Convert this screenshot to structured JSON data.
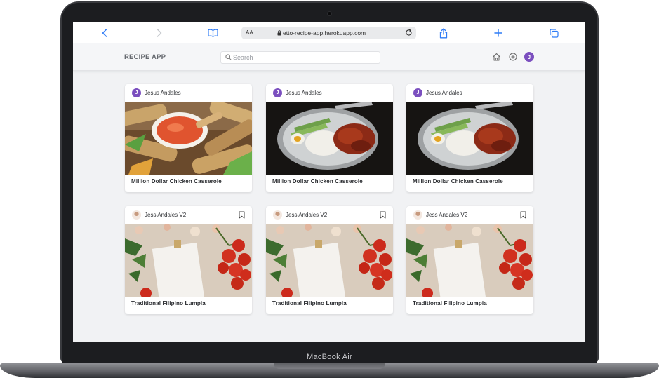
{
  "device": {
    "brand_label": "MacBook Air"
  },
  "browser": {
    "text_size_label": "AA",
    "url": "etto-recipe-app.herokuapp.com"
  },
  "app": {
    "title": "RECIPE APP",
    "search": {
      "placeholder": "Search",
      "value": ""
    },
    "user_initial": "J",
    "accent_color": "#7b4fbf"
  },
  "recipes": [
    {
      "author": "Jesus Andales",
      "author_initial": "J",
      "title": "Million Dollar Chicken Casserole",
      "image": "lumpia-spring-rolls-photo",
      "bookmark": false
    },
    {
      "author": "Jesus Andales",
      "author_initial": "J",
      "title": "Million Dollar Chicken Casserole",
      "image": "chicken-rice-plate-photo",
      "bookmark": false
    },
    {
      "author": "Jesus Andales",
      "author_initial": "J",
      "title": "Million Dollar Chicken Casserole",
      "image": "chicken-rice-plate-photo",
      "bookmark": false
    },
    {
      "author": "Jess Andales V2",
      "author_initial": "",
      "title": "Traditional Filipino Lumpia",
      "image": "recipe-paper-tomatoes-photo",
      "bookmark": true
    },
    {
      "author": "Jess Andales V2",
      "author_initial": "",
      "title": "Traditional Filipino Lumpia",
      "image": "recipe-paper-tomatoes-photo",
      "bookmark": true
    },
    {
      "author": "Jess Andales V2",
      "author_initial": "",
      "title": "Traditional Filipino Lumpia",
      "image": "recipe-paper-tomatoes-photo",
      "bookmark": true
    }
  ]
}
